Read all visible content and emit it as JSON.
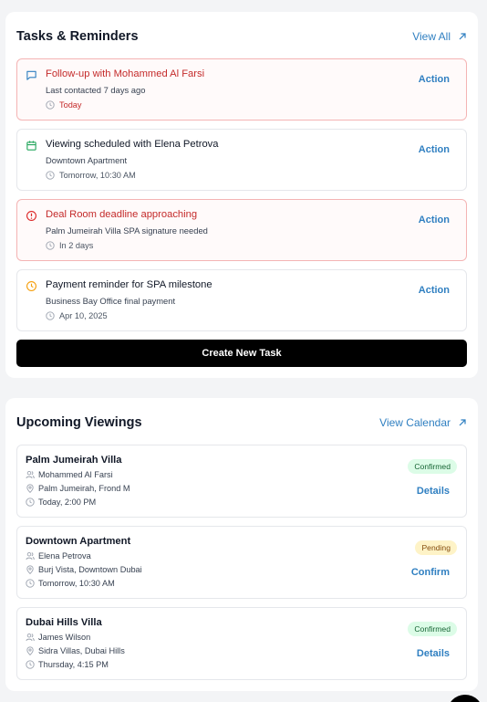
{
  "tasks_card": {
    "title": "Tasks & Reminders",
    "view_all_label": "View All",
    "create_label": "Create New Task",
    "tasks": [
      {
        "icon": "message-icon",
        "title": "Follow-up with Mohammed Al Farsi",
        "subtitle": "Last contacted 7 days ago",
        "due": "Today",
        "action": "Action",
        "urgent": true
      },
      {
        "icon": "calendar-icon",
        "title": "Viewing scheduled with Elena Petrova",
        "subtitle": "Downtown Apartment",
        "due": "Tomorrow, 10:30 AM",
        "action": "Action",
        "urgent": false
      },
      {
        "icon": "alert-circle-icon",
        "title": "Deal Room deadline approaching",
        "subtitle": "Palm Jumeirah Villa SPA signature needed",
        "due": "In 2 days",
        "action": "Action",
        "urgent": true
      },
      {
        "icon": "clock-icon",
        "title": "Payment reminder for SPA milestone",
        "subtitle": "Business Bay Office final payment",
        "due": "Apr 10, 2025",
        "action": "Action",
        "urgent": false
      }
    ]
  },
  "viewings_card": {
    "title": "Upcoming Viewings",
    "view_calendar_label": "View Calendar",
    "viewings": [
      {
        "title": "Palm Jumeirah Villa",
        "client": "Mohammed Al Farsi",
        "location": "Palm Jumeirah, Frond M",
        "time": "Today, 2:00 PM",
        "status": "Confirmed",
        "action": "Details"
      },
      {
        "title": "Downtown Apartment",
        "client": "Elena Petrova",
        "location": "Burj Vista, Downtown Dubai",
        "time": "Tomorrow, 10:30 AM",
        "status": "Pending",
        "action": "Confirm"
      },
      {
        "title": "Dubai Hills Villa",
        "client": "James Wilson",
        "location": "Sidra Villas, Dubai Hills",
        "time": "Thursday, 4:15 PM",
        "status": "Confirmed",
        "action": "Details"
      }
    ]
  },
  "colors": {
    "link": "#2f7fc1",
    "urgent": "#c42b2b",
    "confirmed_bg": "#dcfce7",
    "pending_bg": "#fef3c7"
  }
}
